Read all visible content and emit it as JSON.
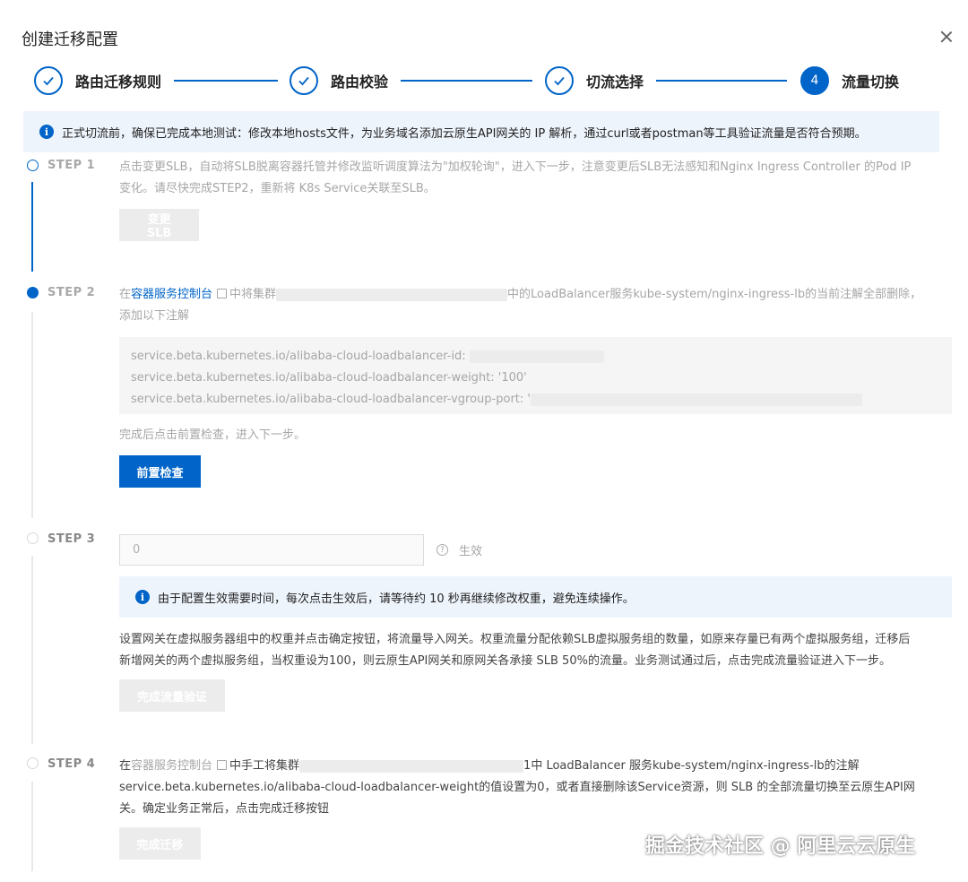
{
  "dialog": {
    "title": "创建迁移配置"
  },
  "stepper": {
    "steps": [
      {
        "label": "路由迁移规则",
        "state": "done"
      },
      {
        "label": "路由校验",
        "state": "done"
      },
      {
        "label": "切流选择",
        "state": "done"
      },
      {
        "label": "流量切换",
        "state": "active",
        "number": "4"
      }
    ]
  },
  "notice": {
    "icon": "info-icon",
    "text": "正式切流前，确保已完成本地测试：修改本地hosts文件，为业务域名添加云原生API网关的 IP 解析，通过curl或者postman等工具验证流量是否符合预期。"
  },
  "steps": {
    "s1": {
      "tag": "STEP 1",
      "desc_line1": "点击变更SLB，自动将SLB脱离容器托管并修改监听调度算法为\"加权轮询\"，进入下一步，注意变更后SLB无法感知和Nginx Ingress Controller 的Pod IP",
      "desc_line2": "变化。请尽快完成STEP2，重新将 K8s Service关联至SLB。",
      "button": "变更SLB"
    },
    "s2": {
      "tag": "STEP 2",
      "prefix": "在",
      "link": "容器服务控制台",
      "mid": "中将集群",
      "suffix": "中的LoadBalancer服务kube-system/nginx-ingress-lb的当前注解全部删除，",
      "line2": "添加以下注解",
      "code": [
        "service.beta.kubernetes.io/alibaba-cloud-loadbalancer-id:",
        "service.beta.kubernetes.io/alibaba-cloud-loadbalancer-weight: '100'",
        "service.beta.kubernetes.io/alibaba-cloud-loadbalancer-vgroup-port: '"
      ],
      "after": "完成后点击前置检查，进入下一步。",
      "button": "前置检查"
    },
    "s3": {
      "tag": "STEP 3",
      "input_value": "0",
      "effect": "生效",
      "notice": "由于配置生效需要时间，每次点击生效后，请等待约 10 秒再继续修改权重，避免连续操作。",
      "desc_line1": "设置网关在虚拟服务器组中的权重并点击确定按钮，将流量导入网关。权重流量分配依赖SLB虚拟服务组的数量，如原来存量已有两个虚拟服务组，迁移后",
      "desc_line2": "新增网关的两个虚拟服务组，当权重设为100，则云原生API网关和原网关各承接 SLB 50%的流量。业务测试通过后，点击完成流量验证进入下一步。",
      "button": "完成流量验证"
    },
    "s4": {
      "tag": "STEP 4",
      "prefix": "在",
      "link": "容器服务控制台",
      "mid": "中手工将集群",
      "suffix": "1中 LoadBalancer 服务kube-system/nginx-ingress-lb的注解",
      "line2": "service.beta.kubernetes.io/alibaba-cloud-loadbalancer-weight的值设置为0，或者直接删除该Service资源，则 SLB 的全部流量切换至云原生API网",
      "line3": "关。确定业务正常后，点击完成迁移按钮",
      "button": "完成迁移"
    }
  },
  "watermark": "掘金技术社区 @ 阿里云云原生",
  "colors": {
    "primary": "#0064c8",
    "notice_bg": "#eef4fc",
    "disabled_btn": "#ececec"
  }
}
